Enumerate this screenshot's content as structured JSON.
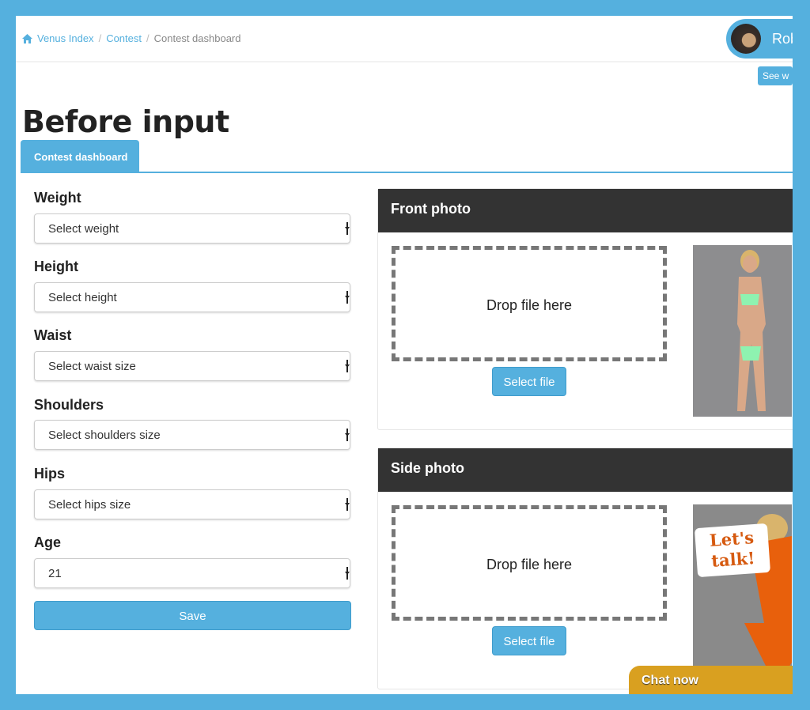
{
  "breadcrumb": {
    "home": "Venus Index",
    "contest": "Contest",
    "current": "Contest dashboard"
  },
  "user": {
    "name": "Rob",
    "see_button": "See w"
  },
  "page_title": "Before input",
  "tabs": [
    {
      "label": "Contest dashboard",
      "active": true
    }
  ],
  "form": {
    "fields": [
      {
        "label": "Weight",
        "value": "Select weight"
      },
      {
        "label": "Height",
        "value": "Select height"
      },
      {
        "label": "Waist",
        "value": "Select waist size"
      },
      {
        "label": "Shoulders",
        "value": "Select shoulders size"
      },
      {
        "label": "Hips",
        "value": "Select hips size"
      },
      {
        "label": "Age",
        "value": "21"
      }
    ],
    "save_label": "Save"
  },
  "panels": [
    {
      "title": "Front photo",
      "drop_text": "Drop file here",
      "button": "Select file"
    },
    {
      "title": "Side photo",
      "drop_text": "Drop file here",
      "button": "Select file"
    }
  ],
  "chat_widget": {
    "badge": "Let's talk!",
    "button": "Chat now"
  },
  "colors": {
    "accent": "#55b0de",
    "panel_header": "#333333",
    "chat": "#d9a020"
  }
}
